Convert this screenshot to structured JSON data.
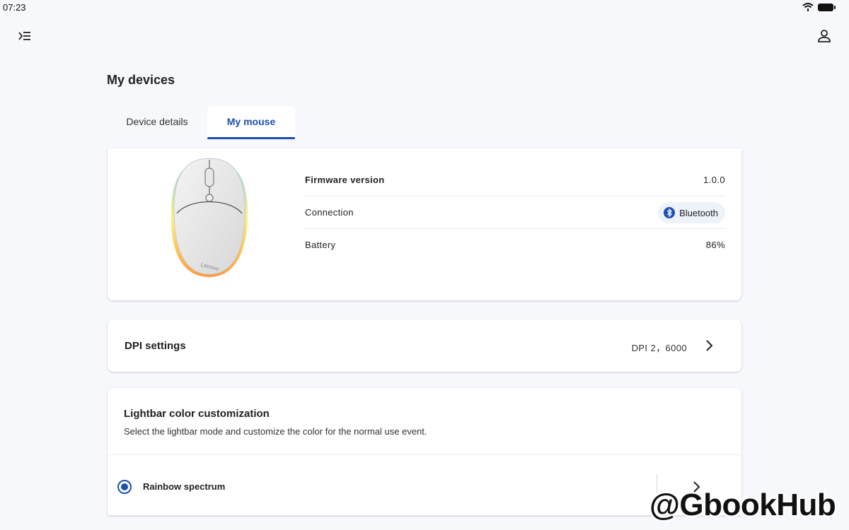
{
  "status_bar": {
    "time": "07:23"
  },
  "header": {
    "title": "My devices"
  },
  "tabs": [
    {
      "label": "Device details",
      "active": false
    },
    {
      "label": "My mouse",
      "active": true
    }
  ],
  "device_info": {
    "firmware_label": "Firmware version",
    "firmware_value": "1.0.0",
    "connection_label": "Connection",
    "connection_value": "Bluetooth",
    "battery_label": "Battery",
    "battery_value": "86%",
    "mouse_brand": "Lenovo"
  },
  "dpi": {
    "title": "DPI settings",
    "value": "DPI 2，6000"
  },
  "lightbar": {
    "title": "Lightbar color customization",
    "description": "Select the lightbar mode and customize the color for the normal use event.",
    "mode_label": "Rainbow spectrum",
    "mode_selected": true
  },
  "watermark": "@GbookHub",
  "colors": {
    "accent": "#1d4fb0",
    "background": "#f7f8fb",
    "card": "#ffffff"
  }
}
